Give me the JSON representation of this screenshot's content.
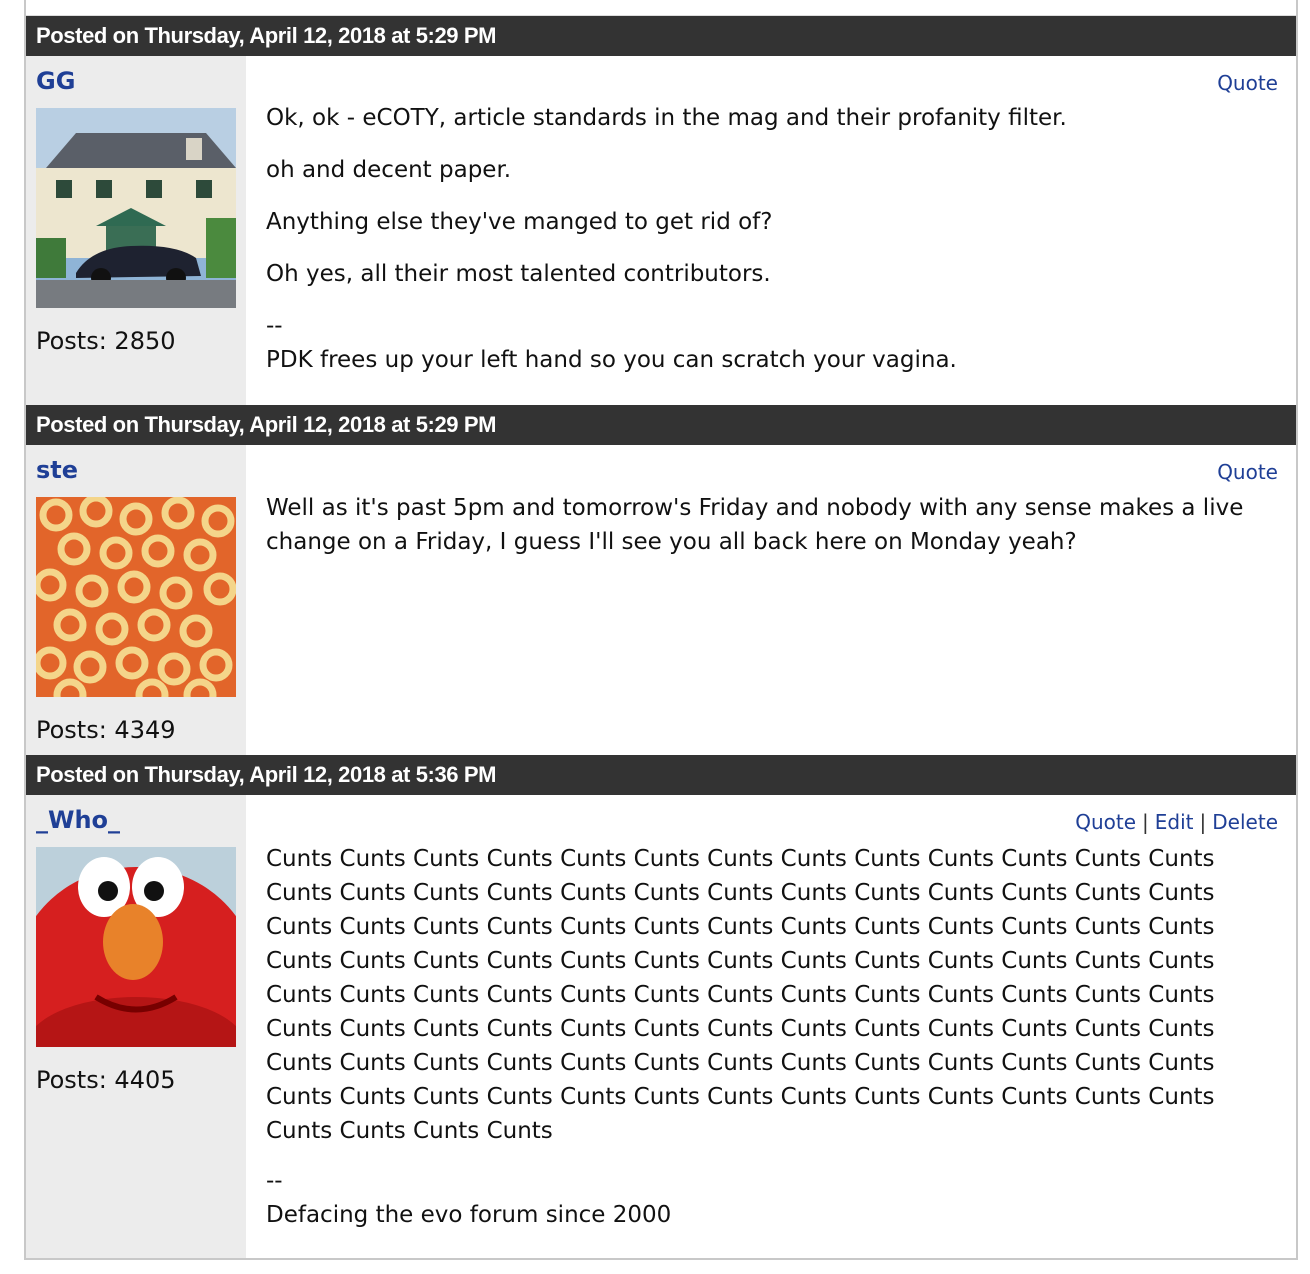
{
  "posts": [
    {
      "header": "Posted on Thursday, April 12, 2018 at 5:29 PM",
      "username": "GG",
      "avatar_icon": "house-with-porsche-photo",
      "posts_count": "Posts: 2850",
      "actions": [
        "Quote"
      ],
      "paragraphs": [
        "Ok, ok - eCOTY, article standards in the mag and their profanity filter.",
        "oh and decent paper.",
        "Anything else they've manged to get rid of?",
        "Oh yes, all their most talented contributors."
      ],
      "sig_dash": "--",
      "signature": "PDK frees up your left hand so you can scratch your vagina."
    },
    {
      "header": "Posted on Thursday, April 12, 2018 at 5:29 PM",
      "username": "ste",
      "avatar_icon": "spaghetti-hoops-photo",
      "posts_count": "Posts: 4349",
      "actions": [
        "Quote"
      ],
      "paragraphs": [
        "Well as it's past 5pm and tomorrow's Friday and nobody with any sense makes a live change on a Friday, I guess I'll see you all back here on Monday yeah?"
      ]
    },
    {
      "header": "Posted on Thursday, April 12, 2018 at 5:36 PM",
      "username": "_Who_",
      "avatar_icon": "elmo-photo",
      "posts_count": "Posts: 4405",
      "actions": [
        "Quote",
        "Edit",
        "Delete"
      ],
      "separator": "|",
      "body_lines": [
        "Cunts Cunts Cunts Cunts Cunts Cunts Cunts Cunts Cunts Cunts Cunts Cunts Cunts",
        "Cunts Cunts Cunts Cunts Cunts Cunts Cunts Cunts Cunts Cunts Cunts Cunts Cunts",
        "Cunts Cunts Cunts Cunts Cunts Cunts Cunts Cunts Cunts Cunts Cunts Cunts Cunts",
        "Cunts Cunts Cunts Cunts Cunts Cunts Cunts Cunts Cunts Cunts Cunts Cunts Cunts",
        "Cunts Cunts Cunts Cunts Cunts Cunts Cunts Cunts Cunts Cunts Cunts Cunts Cunts",
        "Cunts Cunts Cunts Cunts Cunts Cunts Cunts Cunts Cunts Cunts Cunts Cunts Cunts",
        "Cunts Cunts Cunts Cunts Cunts Cunts Cunts Cunts Cunts Cunts Cunts Cunts Cunts",
        "Cunts Cunts Cunts Cunts Cunts Cunts Cunts Cunts Cunts Cunts Cunts Cunts Cunts",
        "Cunts Cunts Cunts Cunts"
      ],
      "sig_dash": "--",
      "signature": "Defacing the evo forum since 2000"
    }
  ]
}
